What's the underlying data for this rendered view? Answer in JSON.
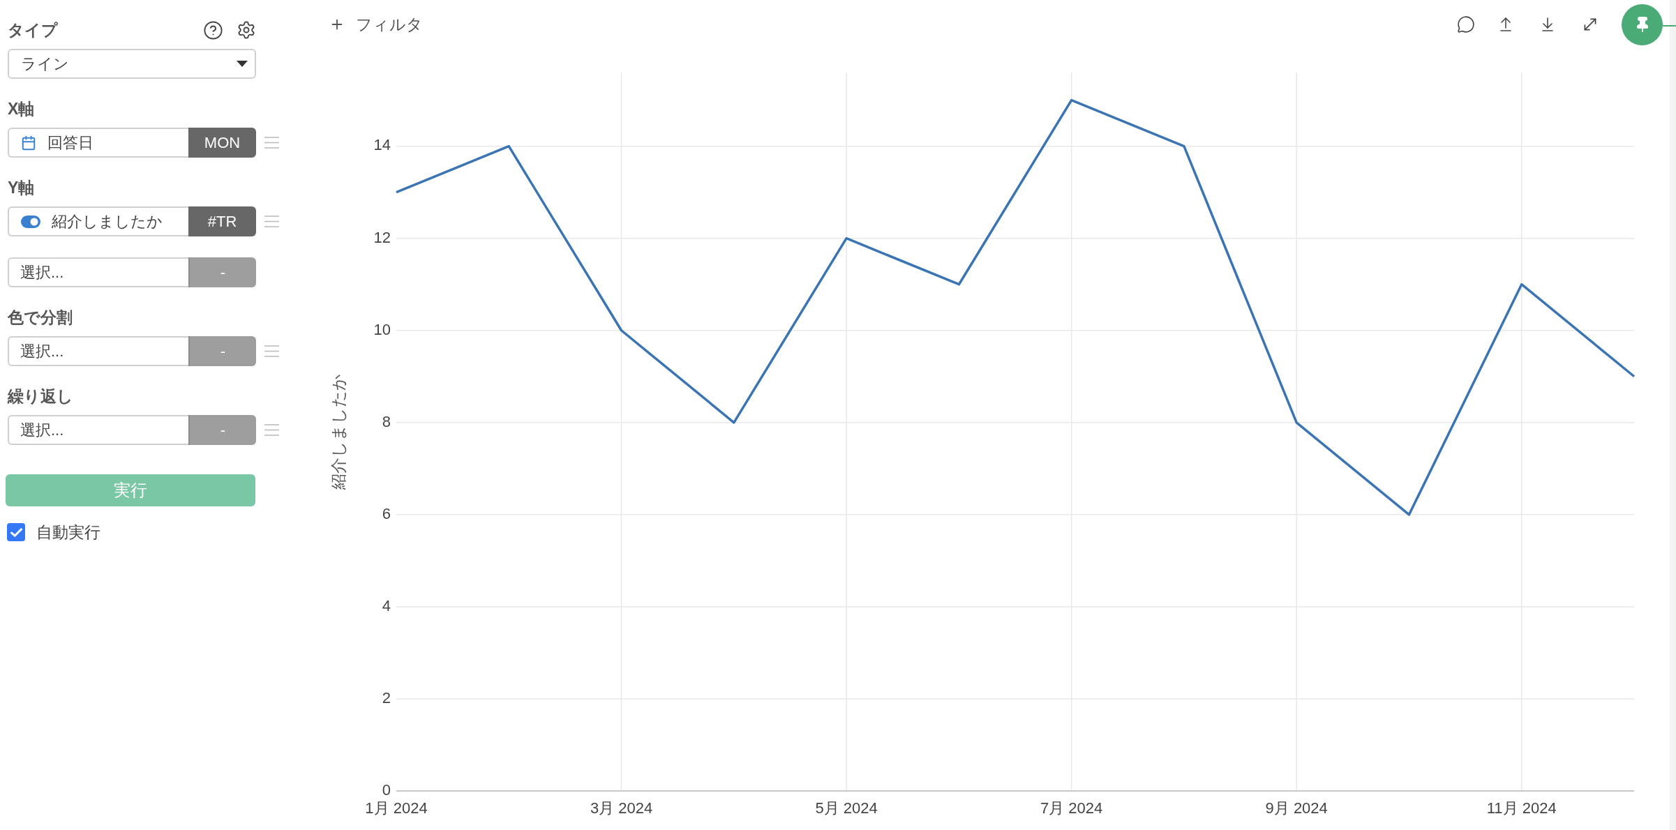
{
  "toolbar": {
    "filter_button": {
      "label": "フィルタ"
    }
  },
  "sidebar": {
    "type": {
      "label": "タイプ",
      "value": "ライン"
    },
    "sections": [
      {
        "label": "X軸",
        "fields": [
          {
            "kind": "date",
            "value": "回答日",
            "aggregation": "MON",
            "draggable": true
          }
        ]
      },
      {
        "label": "Y軸",
        "fields": [
          {
            "kind": "boolean",
            "value": "紹介しましたか",
            "aggregation": "#TR",
            "draggable": true
          },
          {
            "kind": "empty",
            "placeholder": "選択...",
            "aggregation": "-",
            "draggable": false
          }
        ]
      },
      {
        "label": "色で分割",
        "fields": [
          {
            "kind": "empty",
            "placeholder": "選択...",
            "aggregation": "-",
            "draggable": true
          }
        ]
      },
      {
        "label": "繰り返し",
        "fields": [
          {
            "kind": "empty",
            "placeholder": "選択...",
            "aggregation": "-",
            "draggable": true
          }
        ]
      }
    ],
    "run_button": {
      "label": "実行",
      "disabled": true
    },
    "auto_run": {
      "label": "自動実行",
      "checked": true
    }
  },
  "chart": {
    "chart_data": {
      "type": "line",
      "ylabel": "紹介しましたか",
      "categories": [
        "1月 2024",
        null,
        "3月 2024",
        null,
        "5月 2024",
        null,
        "7月 2024",
        null,
        "9月 2024",
        null,
        "11月 2024",
        null
      ],
      "series": [
        {
          "color": "#3a74b2",
          "values": [
            13,
            14,
            10,
            8,
            12,
            11,
            15,
            14,
            8,
            6,
            11,
            9
          ]
        }
      ],
      "ylim": [
        0,
        15.6
      ],
      "yticks": [
        0,
        2,
        4,
        6,
        8,
        10,
        12,
        14
      ],
      "grid": true
    }
  }
}
